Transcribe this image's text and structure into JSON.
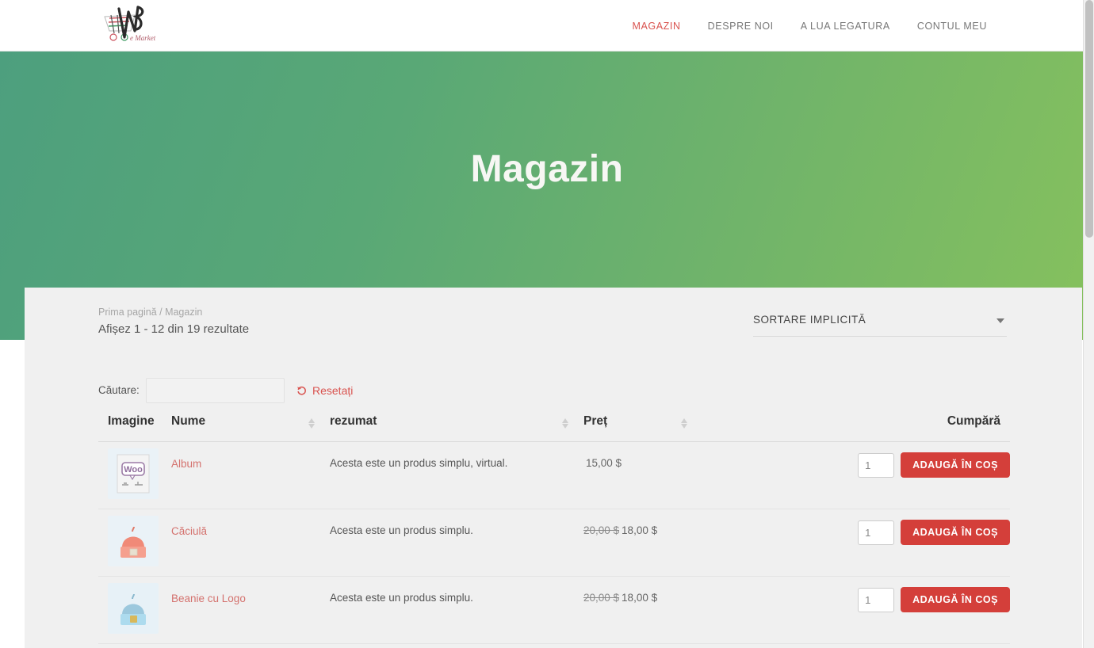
{
  "header": {
    "logo_icon": "emarket-cart-logo",
    "logo_text": "e Market",
    "nav": [
      {
        "label": "MAGAZIN",
        "active": true
      },
      {
        "label": "DESPRE NOI",
        "active": false
      },
      {
        "label": "A LUA LEGATURA",
        "active": false
      },
      {
        "label": "CONTUL MEU",
        "active": false
      }
    ]
  },
  "hero": {
    "title": "Magazin",
    "gradient_from": "#4d9f7e",
    "gradient_to": "#86c15d"
  },
  "content": {
    "breadcrumb": "Prima pagină / Magazin",
    "result_count": "Afișez 1 - 12 din 19 rezultate",
    "sort": {
      "selected": "SORTARE IMPLICITĂ",
      "caret_icon": "chevron-down-icon"
    },
    "search": {
      "label": "Căutare:",
      "value": "",
      "placeholder": ""
    },
    "reset": {
      "label": "Resetați",
      "icon": "undo-arrow-icon",
      "color": "#d9534f"
    }
  },
  "table": {
    "headers": {
      "image": "Imagine",
      "name": "Nume",
      "summary": "rezumat",
      "price": "Preț",
      "buy": "Cumpără"
    },
    "rows": [
      {
        "thumb": "woo-album-placeholder",
        "name": "Album",
        "summary": "Acesta este un produs simplu, virtual.",
        "price_old": "",
        "price": "15,00 $",
        "qty": "1",
        "add_label": "ADAUGĂ ÎN COȘ"
      },
      {
        "thumb": "beanie-salmon",
        "name": "Căciulă",
        "summary": "Acesta este un produs simplu.",
        "price_old": "20,00 $",
        "price": "18,00 $",
        "qty": "1",
        "add_label": "ADAUGĂ ÎN COȘ"
      },
      {
        "thumb": "beanie-blue-logo",
        "name": "Beanie cu Logo",
        "summary": "Acesta este un produs simplu.",
        "price_old": "20,00 $",
        "price": "18,00 $",
        "qty": "1",
        "add_label": "ADAUGĂ ÎN COȘ"
      }
    ]
  },
  "theme": {
    "accent_red": "#d43f3a",
    "link_red": "#d4726e",
    "card_bg": "#f0f0f0"
  }
}
